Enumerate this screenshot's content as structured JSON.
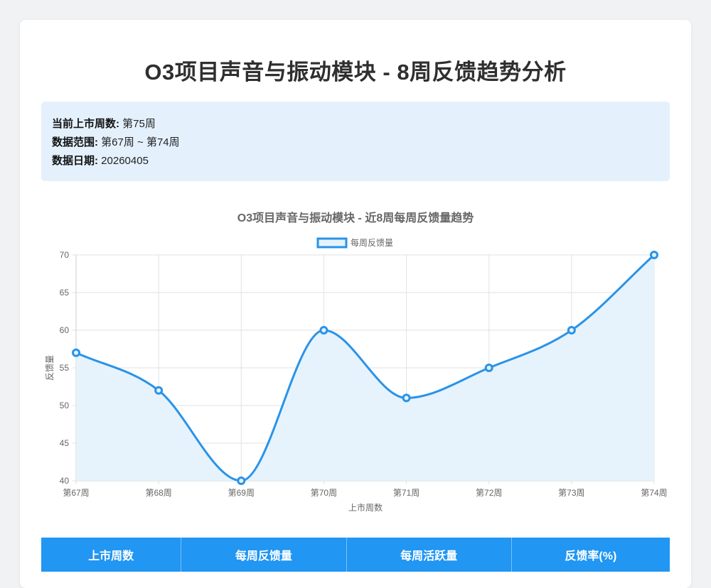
{
  "page": {
    "title": "O3项目声音与振动模块 - 8周反馈趋势分析"
  },
  "info": {
    "rows": [
      {
        "label": "当前上市周数:",
        "value": "第75周"
      },
      {
        "label": "数据范围:",
        "value": "第67周 ~ 第74周"
      },
      {
        "label": "数据日期:",
        "value": "20260405"
      }
    ]
  },
  "chart_data": {
    "type": "line",
    "title": "O3项目声音与振动模块 - 近8周每周反馈量趋势",
    "xlabel": "上市周数",
    "ylabel": "反馈量",
    "categories": [
      "第67周",
      "第68周",
      "第69周",
      "第70周",
      "第71周",
      "第72周",
      "第73周",
      "第74周"
    ],
    "series": [
      {
        "name": "每周反馈量",
        "values": [
          57,
          52,
          40,
          60,
          51,
          55,
          60,
          70
        ],
        "color": "#2a93e8",
        "fill": "#e6f3fc"
      }
    ],
    "ylim": [
      40,
      70
    ],
    "yticks": [
      70,
      65,
      60,
      55,
      50,
      45,
      40
    ],
    "grid": true,
    "legend": "top-center",
    "smooth": true
  },
  "table": {
    "headers": [
      "上市周数",
      "每周反馈量",
      "每周活跃量",
      "反馈率(%)"
    ]
  }
}
